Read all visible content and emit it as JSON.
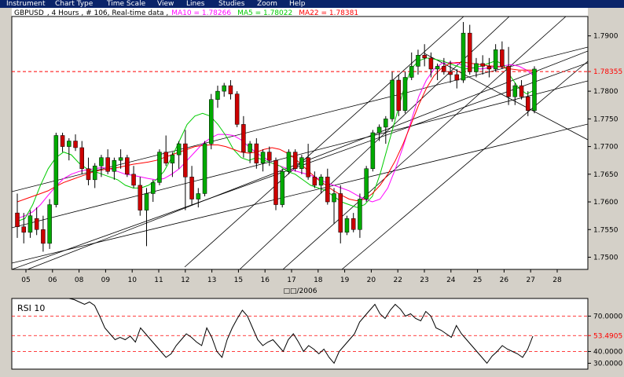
{
  "menu": [
    "Instrument",
    "Chart Type",
    "Time Scale",
    "View",
    "Lines",
    "Studies",
    "Zoom",
    "Help"
  ],
  "header": {
    "symbol": "GBPUSD",
    "info": ", 4 Hours , # 106, Real-time data ,",
    "ma10": "MA10 = 1.78266",
    "ma5": "MA5 = 1.78022",
    "ma22": "MA22 = 1.78381",
    "ma10_color": "#ff00ff",
    "ma5_color": "#00cc00",
    "ma22_color": "#ff0000"
  },
  "colors": {
    "up": "#00aa00",
    "down": "#cc0000",
    "bg": "#ffffff",
    "panel": "#d4d0c8",
    "grid": "#000000"
  },
  "chart_data": [
    {
      "type": "candlestick",
      "title": "GBPUSD , 4 Hours , # 106, Real-time data",
      "xlabel": "□□/2006",
      "ylim": [
        1.7478,
        1.7935
      ],
      "yticks": [
        "1.7500",
        "1.7550",
        "1.7600",
        "1.7650",
        "1.7700",
        "1.7750",
        "1.7800",
        "1.7900"
      ],
      "current_price": "1.78355",
      "xticks": [
        "05",
        "06",
        "08",
        "09",
        "10",
        "11",
        "12",
        "13",
        "15",
        "16",
        "17",
        "18",
        "19",
        "20",
        "22",
        "23",
        "24",
        "25",
        "26",
        "27",
        "28"
      ],
      "series": [
        {
          "name": "MA10 = 1.78266",
          "color": "#ff00ff",
          "values": [
            1.757,
            1.7575,
            1.7582,
            1.7595,
            1.7612,
            1.7628,
            1.7642,
            1.765,
            1.7655,
            1.7658,
            1.766,
            1.7662,
            1.766,
            1.7655,
            1.765,
            1.7648,
            1.7645,
            1.7642,
            1.764,
            1.7642,
            1.765,
            1.766,
            1.7675,
            1.769,
            1.7705,
            1.7715,
            1.7722,
            1.7722,
            1.772,
            1.7712,
            1.77,
            1.7688,
            1.768,
            1.767,
            1.7665,
            1.766,
            1.7656,
            1.7652,
            1.7648,
            1.7642,
            1.7635,
            1.763,
            1.7625,
            1.762,
            1.7612,
            1.7605,
            1.76,
            1.7605,
            1.7625,
            1.766,
            1.77,
            1.7745,
            1.779,
            1.782,
            1.784,
            1.785,
            1.7852,
            1.785,
            1.7846,
            1.7842,
            1.784,
            1.7842,
            1.7844,
            1.7846,
            1.7848,
            1.7845,
            1.7838,
            1.7827
          ]
        },
        {
          "name": "MA5 = 1.78022",
          "color": "#00cc00",
          "values": [
            1.7565,
            1.757,
            1.7595,
            1.763,
            1.766,
            1.768,
            1.769,
            1.7685,
            1.767,
            1.766,
            1.7655,
            1.765,
            1.7645,
            1.764,
            1.763,
            1.7625,
            1.7625,
            1.763,
            1.764,
            1.7655,
            1.768,
            1.771,
            1.774,
            1.7755,
            1.776,
            1.7755,
            1.774,
            1.772,
            1.7695,
            1.768,
            1.7675,
            1.768,
            1.7675,
            1.767,
            1.7665,
            1.7655,
            1.765,
            1.764,
            1.763,
            1.7625,
            1.762,
            1.761,
            1.76,
            1.7595,
            1.759,
            1.7595,
            1.761,
            1.765,
            1.77,
            1.775,
            1.78,
            1.784,
            1.7855,
            1.786,
            1.7858,
            1.7855,
            1.785,
            1.7845,
            1.784,
            1.7842,
            1.7845,
            1.785,
            1.7855,
            1.7848,
            1.7825,
            1.7805,
            1.7795,
            1.7802
          ]
        },
        {
          "name": "MA22 = 1.78381",
          "color": "#ff0000",
          "values": [
            1.76,
            1.7605,
            1.761,
            1.7615,
            1.762,
            1.7628,
            1.7635,
            1.764,
            1.7645,
            1.765,
            1.7655,
            1.7658,
            1.766,
            1.7662,
            1.7665,
            1.7668,
            1.767,
            1.7672,
            1.7675,
            1.768,
            1.7685,
            1.769,
            1.7695,
            1.77,
            1.7702,
            1.7703,
            1.7703,
            1.77,
            1.7695,
            1.769,
            1.7688,
            1.769,
            1.7695,
            1.7698,
            1.7695,
            1.7688,
            1.7678,
            1.7665,
            1.7652,
            1.764,
            1.763,
            1.762,
            1.7612,
            1.7605,
            1.7602,
            1.7605,
            1.7615,
            1.763,
            1.765,
            1.7675,
            1.7705,
            1.774,
            1.7775,
            1.7805,
            1.7828,
            1.7842,
            1.785,
            1.7852,
            1.7852,
            1.785,
            1.7848,
            1.7846,
            1.7845,
            1.7843,
            1.784,
            1.7838,
            1.7838,
            1.7838
          ]
        }
      ],
      "candles": [
        {
          "o": 1.758,
          "h": 1.7615,
          "l": 1.7535,
          "c": 1.7555
        },
        {
          "o": 1.7555,
          "h": 1.758,
          "l": 1.7525,
          "c": 1.7545
        },
        {
          "o": 1.7545,
          "h": 1.7585,
          "l": 1.7535,
          "c": 1.7575
        },
        {
          "o": 1.757,
          "h": 1.759,
          "l": 1.754,
          "c": 1.755
        },
        {
          "o": 1.755,
          "h": 1.7575,
          "l": 1.751,
          "c": 1.7525
        },
        {
          "o": 1.7525,
          "h": 1.7605,
          "l": 1.7515,
          "c": 1.7595
        },
        {
          "o": 1.7595,
          "h": 1.7725,
          "l": 1.759,
          "c": 1.772
        },
        {
          "o": 1.772,
          "h": 1.7725,
          "l": 1.769,
          "c": 1.77
        },
        {
          "o": 1.77,
          "h": 1.7715,
          "l": 1.7675,
          "c": 1.771
        },
        {
          "o": 1.771,
          "h": 1.7722,
          "l": 1.7692,
          "c": 1.7698
        },
        {
          "o": 1.7698,
          "h": 1.771,
          "l": 1.765,
          "c": 1.766
        },
        {
          "o": 1.766,
          "h": 1.768,
          "l": 1.763,
          "c": 1.764
        },
        {
          "o": 1.764,
          "h": 1.767,
          "l": 1.7625,
          "c": 1.7665
        },
        {
          "o": 1.7665,
          "h": 1.7685,
          "l": 1.7645,
          "c": 1.768
        },
        {
          "o": 1.768,
          "h": 1.7695,
          "l": 1.765,
          "c": 1.7655
        },
        {
          "o": 1.7655,
          "h": 1.768,
          "l": 1.764,
          "c": 1.7675
        },
        {
          "o": 1.7675,
          "h": 1.7695,
          "l": 1.766,
          "c": 1.768
        },
        {
          "o": 1.768,
          "h": 1.7685,
          "l": 1.7645,
          "c": 1.765
        },
        {
          "o": 1.765,
          "h": 1.7665,
          "l": 1.7625,
          "c": 1.763
        },
        {
          "o": 1.763,
          "h": 1.7645,
          "l": 1.7575,
          "c": 1.7585
        },
        {
          "o": 1.7585,
          "h": 1.7625,
          "l": 1.752,
          "c": 1.7615
        },
        {
          "o": 1.7615,
          "h": 1.764,
          "l": 1.76,
          "c": 1.7635
        },
        {
          "o": 1.7635,
          "h": 1.7695,
          "l": 1.763,
          "c": 1.769
        },
        {
          "o": 1.769,
          "h": 1.772,
          "l": 1.7665,
          "c": 1.767
        },
        {
          "o": 1.767,
          "h": 1.769,
          "l": 1.7645,
          "c": 1.7685
        },
        {
          "o": 1.7685,
          "h": 1.771,
          "l": 1.766,
          "c": 1.7705
        },
        {
          "o": 1.7705,
          "h": 1.773,
          "l": 1.7585,
          "c": 1.7645
        },
        {
          "o": 1.7645,
          "h": 1.7665,
          "l": 1.7595,
          "c": 1.7605
        },
        {
          "o": 1.7605,
          "h": 1.7625,
          "l": 1.759,
          "c": 1.7615
        },
        {
          "o": 1.7615,
          "h": 1.771,
          "l": 1.761,
          "c": 1.7705
        },
        {
          "o": 1.7705,
          "h": 1.7795,
          "l": 1.7695,
          "c": 1.7785
        },
        {
          "o": 1.7785,
          "h": 1.781,
          "l": 1.777,
          "c": 1.78
        },
        {
          "o": 1.78,
          "h": 1.7815,
          "l": 1.779,
          "c": 1.781
        },
        {
          "o": 1.781,
          "h": 1.782,
          "l": 1.7785,
          "c": 1.7795
        },
        {
          "o": 1.7795,
          "h": 1.78,
          "l": 1.7735,
          "c": 1.774
        },
        {
          "o": 1.774,
          "h": 1.7755,
          "l": 1.768,
          "c": 1.769
        },
        {
          "o": 1.769,
          "h": 1.771,
          "l": 1.767,
          "c": 1.7705
        },
        {
          "o": 1.7705,
          "h": 1.7715,
          "l": 1.766,
          "c": 1.767
        },
        {
          "o": 1.767,
          "h": 1.7695,
          "l": 1.7655,
          "c": 1.769
        },
        {
          "o": 1.769,
          "h": 1.77,
          "l": 1.7665,
          "c": 1.7675
        },
        {
          "o": 1.7675,
          "h": 1.768,
          "l": 1.7585,
          "c": 1.7595
        },
        {
          "o": 1.7595,
          "h": 1.766,
          "l": 1.759,
          "c": 1.7655
        },
        {
          "o": 1.7655,
          "h": 1.7695,
          "l": 1.765,
          "c": 1.769
        },
        {
          "o": 1.769,
          "h": 1.7695,
          "l": 1.7655,
          "c": 1.766
        },
        {
          "o": 1.766,
          "h": 1.7685,
          "l": 1.765,
          "c": 1.768
        },
        {
          "o": 1.768,
          "h": 1.7705,
          "l": 1.764,
          "c": 1.7645
        },
        {
          "o": 1.7645,
          "h": 1.7655,
          "l": 1.7625,
          "c": 1.763
        },
        {
          "o": 1.763,
          "h": 1.765,
          "l": 1.7615,
          "c": 1.7645
        },
        {
          "o": 1.7645,
          "h": 1.766,
          "l": 1.7595,
          "c": 1.76
        },
        {
          "o": 1.76,
          "h": 1.7625,
          "l": 1.756,
          "c": 1.7615
        },
        {
          "o": 1.7615,
          "h": 1.763,
          "l": 1.7525,
          "c": 1.7545
        },
        {
          "o": 1.7545,
          "h": 1.7575,
          "l": 1.754,
          "c": 1.757
        },
        {
          "o": 1.757,
          "h": 1.758,
          "l": 1.7545,
          "c": 1.755
        },
        {
          "o": 1.755,
          "h": 1.7615,
          "l": 1.7535,
          "c": 1.7605
        },
        {
          "o": 1.7605,
          "h": 1.7665,
          "l": 1.76,
          "c": 1.766
        },
        {
          "o": 1.766,
          "h": 1.773,
          "l": 1.7655,
          "c": 1.7725
        },
        {
          "o": 1.7725,
          "h": 1.774,
          "l": 1.771,
          "c": 1.7735
        },
        {
          "o": 1.7735,
          "h": 1.7755,
          "l": 1.7705,
          "c": 1.775
        },
        {
          "o": 1.775,
          "h": 1.7835,
          "l": 1.7745,
          "c": 1.782
        },
        {
          "o": 1.782,
          "h": 1.783,
          "l": 1.7755,
          "c": 1.7765
        },
        {
          "o": 1.7765,
          "h": 1.7835,
          "l": 1.776,
          "c": 1.7825
        },
        {
          "o": 1.7825,
          "h": 1.787,
          "l": 1.782,
          "c": 1.7845
        },
        {
          "o": 1.7845,
          "h": 1.7875,
          "l": 1.783,
          "c": 1.7865
        },
        {
          "o": 1.7865,
          "h": 1.7885,
          "l": 1.7845,
          "c": 1.786
        },
        {
          "o": 1.786,
          "h": 1.787,
          "l": 1.7825,
          "c": 1.784
        },
        {
          "o": 1.784,
          "h": 1.785,
          "l": 1.782,
          "c": 1.7845
        },
        {
          "o": 1.7845,
          "h": 1.786,
          "l": 1.783,
          "c": 1.7835
        },
        {
          "o": 1.7835,
          "h": 1.7855,
          "l": 1.7815,
          "c": 1.783
        },
        {
          "o": 1.783,
          "h": 1.784,
          "l": 1.7805,
          "c": 1.782
        },
        {
          "o": 1.782,
          "h": 1.7925,
          "l": 1.7815,
          "c": 1.7905
        },
        {
          "o": 1.7905,
          "h": 1.792,
          "l": 1.783,
          "c": 1.7835
        },
        {
          "o": 1.7835,
          "h": 1.786,
          "l": 1.7825,
          "c": 1.785
        },
        {
          "o": 1.785,
          "h": 1.7865,
          "l": 1.783,
          "c": 1.7845
        },
        {
          "o": 1.7845,
          "h": 1.786,
          "l": 1.7825,
          "c": 1.784
        },
        {
          "o": 1.784,
          "h": 1.7885,
          "l": 1.7835,
          "c": 1.7875
        },
        {
          "o": 1.7875,
          "h": 1.789,
          "l": 1.784,
          "c": 1.7845
        },
        {
          "o": 1.7845,
          "h": 1.788,
          "l": 1.7775,
          "c": 1.779
        },
        {
          "o": 1.779,
          "h": 1.7815,
          "l": 1.7775,
          "c": 1.781
        },
        {
          "o": 1.781,
          "h": 1.782,
          "l": 1.7785,
          "c": 1.779
        },
        {
          "o": 1.779,
          "h": 1.78,
          "l": 1.7755,
          "c": 1.7765
        },
        {
          "o": 1.7765,
          "h": 1.7845,
          "l": 1.776,
          "c": 1.784
        }
      ]
    },
    {
      "type": "line",
      "title": "RSI 10",
      "ylim": [
        25,
        85
      ],
      "yticks": [
        "70.0000",
        "53.4905",
        "40.0000",
        "30.0000"
      ],
      "current_value": "53.4905",
      "values": [
        85,
        84,
        82,
        80,
        82,
        79,
        70,
        60,
        55,
        50,
        52,
        50,
        53,
        48,
        60,
        55,
        50,
        45,
        40,
        35,
        38,
        45,
        50,
        55,
        52,
        48,
        45,
        60,
        52,
        40,
        35,
        50,
        60,
        68,
        75,
        70,
        60,
        50,
        45,
        48,
        50,
        45,
        40,
        50,
        55,
        48,
        40,
        45,
        42,
        38,
        42,
        35,
        30,
        40,
        45,
        50,
        55,
        65,
        70,
        75,
        80,
        72,
        68,
        75,
        80,
        76,
        70,
        72,
        68,
        66,
        74,
        70,
        60,
        58,
        55,
        52,
        62,
        55,
        50,
        45,
        40,
        35,
        30,
        36,
        40,
        45,
        42,
        40,
        38,
        35,
        42,
        53
      ]
    }
  ]
}
